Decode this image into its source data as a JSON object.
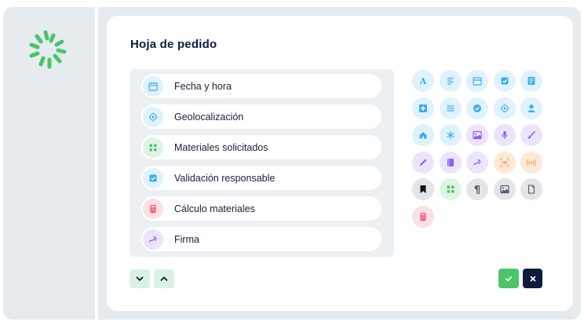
{
  "form": {
    "title": "Hoja de pedido"
  },
  "fields": [
    {
      "label": "Fecha y hora",
      "icon": "calendar-icon"
    },
    {
      "label": "Geolocalización",
      "icon": "geolocation-icon"
    },
    {
      "label": "Materiales solicitados",
      "icon": "grid-icon"
    },
    {
      "label": "Validación responsable",
      "icon": "checkbox-icon"
    },
    {
      "label": "Cálculo materiales",
      "icon": "calculator-icon"
    },
    {
      "label": "Firma",
      "icon": "signature-icon"
    }
  ],
  "palette": {
    "row1": [
      "text-icon",
      "paragraph-lines-icon",
      "calendar-icon",
      "checkbox-icon",
      "form-icon"
    ],
    "row2": [
      "plus-box-icon",
      "list-icon",
      "check-circle-icon",
      "geolocation-icon",
      "user-icon"
    ],
    "row3": [
      "home-icon",
      "asterisk-icon",
      "image-icon",
      "microphone-icon",
      "brush-icon"
    ],
    "row4": [
      "pen-icon",
      "document-icon",
      "signature-icon",
      "code-scan-icon",
      "broadcast-icon"
    ],
    "row5": [
      "bookmark-icon",
      "grid-icon",
      "pilcrow-icon",
      "image-icon",
      "file-icon"
    ],
    "row6": [
      "calculator-icon"
    ]
  },
  "colors": {
    "brand_green": "#4cc46a",
    "navy": "#0d1b3e",
    "icon_blue": "#3aaee8",
    "icon_purple": "#8b5cf6",
    "icon_orange": "#f0a35e",
    "icon_pink": "#f0506e"
  }
}
